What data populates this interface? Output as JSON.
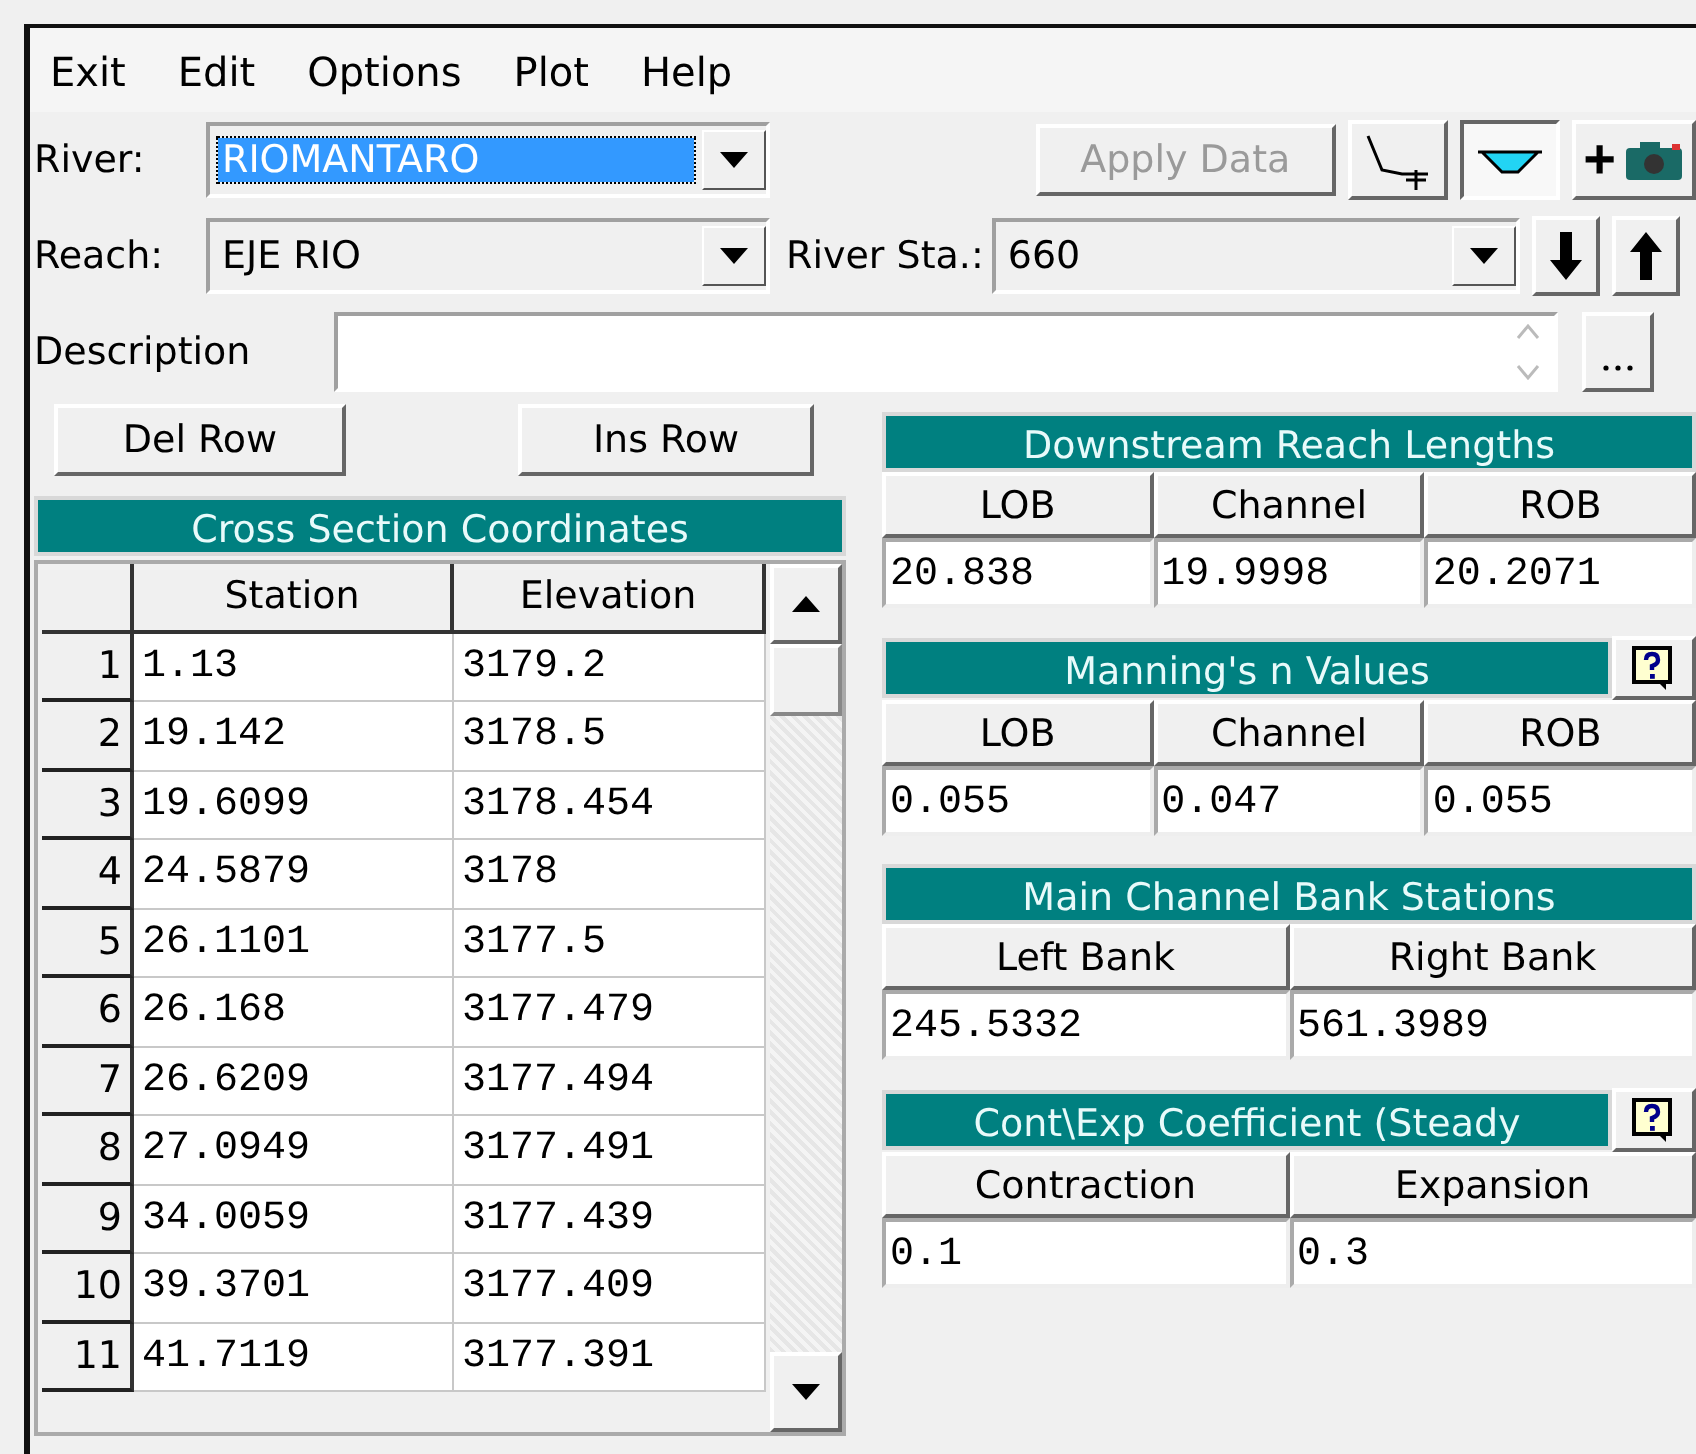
{
  "menu": [
    "Exit",
    "Edit",
    "Options",
    "Plot",
    "Help"
  ],
  "river": {
    "label": "River:",
    "value": "RIOMANTARO",
    "focused": true
  },
  "toolbar": {
    "apply": {
      "label": "Apply Data",
      "disabled": true
    },
    "tools": [
      {
        "kind": "plot",
        "pressed": false
      },
      {
        "kind": "water",
        "pressed": true
      },
      {
        "kind": "camera",
        "label": "+",
        "pressed": false
      }
    ]
  },
  "reach": {
    "label": "Reach:",
    "value": "EJE RIO"
  },
  "river_sta": {
    "label": "River Sta.:",
    "value": "660"
  },
  "description": {
    "label": "Description"
  },
  "row_buttons": [
    "Del Row",
    "Ins Row"
  ],
  "coords": {
    "title": "Cross Section Coordinates",
    "columns": [
      "Station",
      "Elevation"
    ],
    "rows": [
      {
        "n": "1",
        "station": "1.13",
        "elevation": "3179.2"
      },
      {
        "n": "2",
        "station": "19.142",
        "elevation": "3178.5"
      },
      {
        "n": "3",
        "station": "19.6099",
        "elevation": "3178.454"
      },
      {
        "n": "4",
        "station": "24.5879",
        "elevation": "3178"
      },
      {
        "n": "5",
        "station": "26.1101",
        "elevation": "3177.5"
      },
      {
        "n": "6",
        "station": "26.168",
        "elevation": "3177.479"
      },
      {
        "n": "7",
        "station": "26.6209",
        "elevation": "3177.494"
      },
      {
        "n": "8",
        "station": "27.0949",
        "elevation": "3177.491"
      },
      {
        "n": "9",
        "station": "34.0059",
        "elevation": "3177.439"
      },
      {
        "n": "10",
        "station": "39.3701",
        "elevation": "3177.409"
      },
      {
        "n": "11",
        "station": "41.7119",
        "elevation": "3177.391"
      }
    ]
  },
  "panels": [
    {
      "title": "Downstream Reach Lengths",
      "help": false,
      "columns": [
        "LOB",
        "Channel",
        "ROB"
      ],
      "values": [
        "20.838",
        "19.9998",
        "20.2071"
      ]
    },
    {
      "title": "Manning's n Values",
      "help": true,
      "columns": [
        "LOB",
        "Channel",
        "ROB"
      ],
      "values": [
        "0.055",
        "0.047",
        "0.055"
      ]
    },
    {
      "title": "Main Channel Bank Stations",
      "help": false,
      "columns": [
        "Left Bank",
        "Right Bank"
      ],
      "values": [
        "245.5332",
        "561.3989"
      ]
    },
    {
      "title": "Cont\\Exp Coefficient (Steady",
      "help": true,
      "columns": [
        "Contraction",
        "Expansion"
      ],
      "values": [
        "0.1",
        "0.3"
      ]
    }
  ]
}
